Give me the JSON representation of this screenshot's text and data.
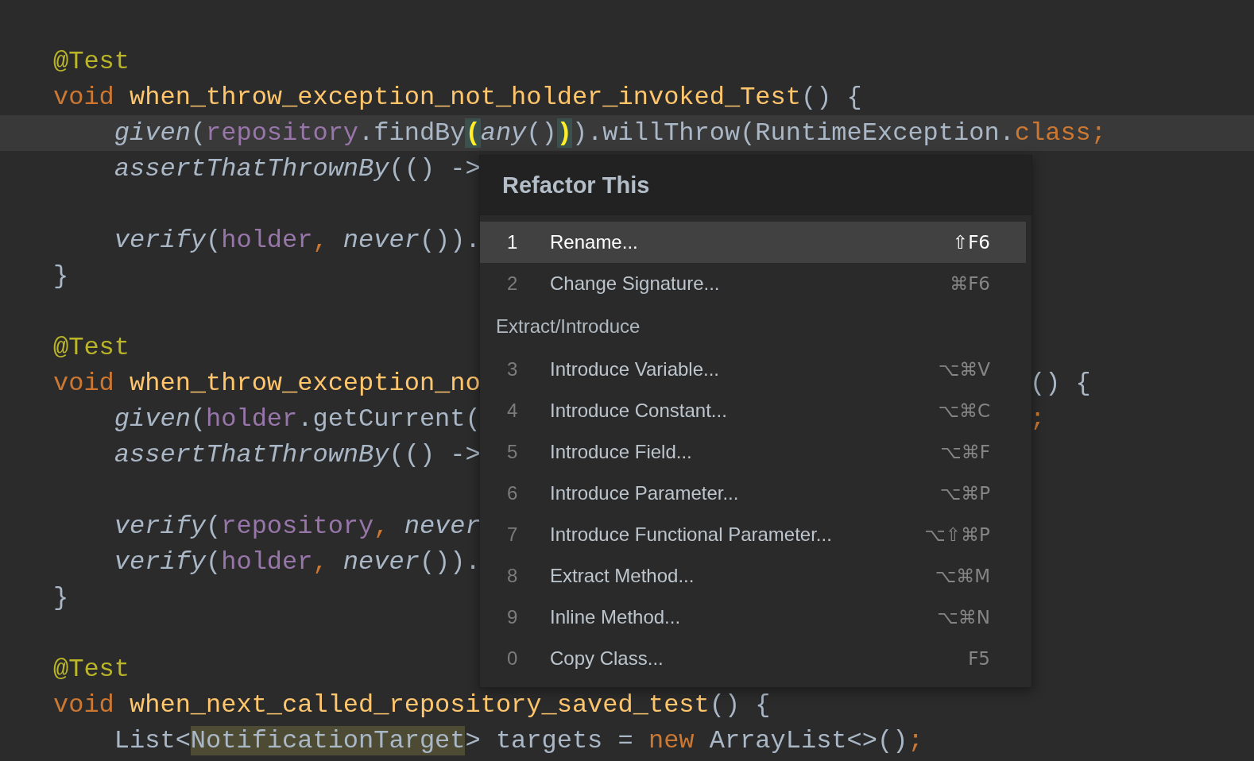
{
  "editor": {
    "lines": [
      {
        "kind": "blank"
      },
      {
        "kind": "code",
        "current": false,
        "tokens": [
          {
            "kind": "annotation",
            "text": "@Test"
          }
        ]
      },
      {
        "kind": "code",
        "current": false,
        "tokens": [
          {
            "kind": "keyword",
            "text": "void "
          },
          {
            "kind": "decl",
            "text": "when_throw_exception_not_holder_invoked_Test"
          },
          {
            "kind": "plain",
            "text": "() {"
          }
        ]
      },
      {
        "kind": "code",
        "current": true,
        "tokens": [
          {
            "kind": "call",
            "text": "    given"
          },
          {
            "kind": "plain",
            "text": "("
          },
          {
            "kind": "field",
            "text": "repository"
          },
          {
            "kind": "plain",
            "text": ".findBy"
          },
          {
            "kind": "brace",
            "text": "("
          },
          {
            "kind": "call",
            "text": "any"
          },
          {
            "kind": "plain",
            "text": "()"
          },
          {
            "kind": "brace",
            "text": ")"
          },
          {
            "kind": "plain",
            "text": ").willThrow(RuntimeException."
          },
          {
            "kind": "keyword",
            "text": "class;"
          }
        ]
      },
      {
        "kind": "code",
        "current": false,
        "tokens": [
          {
            "kind": "call",
            "text": "    assertThatThrownBy"
          },
          {
            "kind": "plain",
            "text": "(() ->"
          }
        ]
      },
      {
        "kind": "blank"
      },
      {
        "kind": "code",
        "current": false,
        "tokens": [
          {
            "kind": "call",
            "text": "    verify"
          },
          {
            "kind": "plain",
            "text": "("
          },
          {
            "kind": "field",
            "text": "holder"
          },
          {
            "kind": "keyword",
            "text": ", "
          },
          {
            "kind": "call",
            "text": "never"
          },
          {
            "kind": "plain",
            "text": "())."
          }
        ]
      },
      {
        "kind": "code",
        "current": false,
        "tokens": [
          {
            "kind": "plain",
            "text": "}"
          }
        ]
      },
      {
        "kind": "blank"
      },
      {
        "kind": "code",
        "current": false,
        "tokens": [
          {
            "kind": "annotation",
            "text": "@Test"
          }
        ]
      },
      {
        "kind": "code",
        "current": false,
        "tokens": [
          {
            "kind": "keyword",
            "text": "void "
          },
          {
            "kind": "decl",
            "text": "when_throw_exception_no"
          }
        ],
        "tail": [
          {
            "kind": "plain",
            "text": "() {"
          }
        ]
      },
      {
        "kind": "code",
        "current": false,
        "tokens": [
          {
            "kind": "call",
            "text": "    given"
          },
          {
            "kind": "plain",
            "text": "("
          },
          {
            "kind": "field",
            "text": "holder"
          },
          {
            "kind": "plain",
            "text": ".getCurrent("
          }
        ],
        "tail": [
          {
            "kind": "keyword",
            "text": ";"
          }
        ]
      },
      {
        "kind": "code",
        "current": false,
        "tokens": [
          {
            "kind": "call",
            "text": "    assertThatThrownBy"
          },
          {
            "kind": "plain",
            "text": "(() ->"
          }
        ]
      },
      {
        "kind": "blank"
      },
      {
        "kind": "code",
        "current": false,
        "tokens": [
          {
            "kind": "call",
            "text": "    verify"
          },
          {
            "kind": "plain",
            "text": "("
          },
          {
            "kind": "field",
            "text": "repository"
          },
          {
            "kind": "keyword",
            "text": ", "
          },
          {
            "kind": "call",
            "text": "never"
          }
        ]
      },
      {
        "kind": "code",
        "current": false,
        "tokens": [
          {
            "kind": "call",
            "text": "    verify"
          },
          {
            "kind": "plain",
            "text": "("
          },
          {
            "kind": "field",
            "text": "holder"
          },
          {
            "kind": "keyword",
            "text": ", "
          },
          {
            "kind": "call",
            "text": "never"
          },
          {
            "kind": "plain",
            "text": "())."
          }
        ]
      },
      {
        "kind": "code",
        "current": false,
        "tokens": [
          {
            "kind": "plain",
            "text": "}"
          }
        ]
      },
      {
        "kind": "blank"
      },
      {
        "kind": "code",
        "current": false,
        "tokens": [
          {
            "kind": "annotation",
            "text": "@Test"
          }
        ]
      },
      {
        "kind": "code",
        "current": false,
        "tokens": [
          {
            "kind": "keyword",
            "text": "void "
          },
          {
            "kind": "decl",
            "text": "when_next_called_repository_saved_test"
          },
          {
            "kind": "plain",
            "text": "() {"
          }
        ]
      },
      {
        "kind": "code",
        "current": false,
        "tokens": [
          {
            "kind": "plain",
            "text": "    List<"
          },
          {
            "kind": "usage",
            "text": "NotificationTarget"
          },
          {
            "kind": "plain",
            "text": "> targets = "
          },
          {
            "kind": "keyword",
            "text": "new "
          },
          {
            "kind": "plain",
            "text": "ArrayList<>()"
          },
          {
            "kind": "keyword",
            "text": ";"
          }
        ]
      }
    ]
  },
  "popup": {
    "title": "Refactor This",
    "items": [
      {
        "kind": "item",
        "number": "1",
        "label": "Rename...",
        "shortcut": "⇧F6",
        "selected": true
      },
      {
        "kind": "item",
        "number": "2",
        "label": "Change Signature...",
        "shortcut": "⌘F6",
        "selected": false
      },
      {
        "kind": "group",
        "label": "Extract/Introduce"
      },
      {
        "kind": "item",
        "number": "3",
        "label": "Introduce Variable...",
        "shortcut": "⌥⌘V",
        "selected": false
      },
      {
        "kind": "item",
        "number": "4",
        "label": "Introduce Constant...",
        "shortcut": "⌥⌘C",
        "selected": false
      },
      {
        "kind": "item",
        "number": "5",
        "label": "Introduce Field...",
        "shortcut": "⌥⌘F",
        "selected": false
      },
      {
        "kind": "item",
        "number": "6",
        "label": "Introduce Parameter...",
        "shortcut": "⌥⌘P",
        "selected": false
      },
      {
        "kind": "item",
        "number": "7",
        "label": "Introduce Functional Parameter...",
        "shortcut": "⌥⇧⌘P",
        "selected": false
      },
      {
        "kind": "item",
        "number": "8",
        "label": "Extract Method...",
        "shortcut": "⌥⌘M",
        "selected": false
      },
      {
        "kind": "item",
        "number": "9",
        "label": "Inline Method...",
        "shortcut": "⌥⌘N",
        "selected": false
      },
      {
        "kind": "item",
        "number": "0",
        "label": "Copy Class...",
        "shortcut": "F5",
        "selected": false
      }
    ]
  }
}
